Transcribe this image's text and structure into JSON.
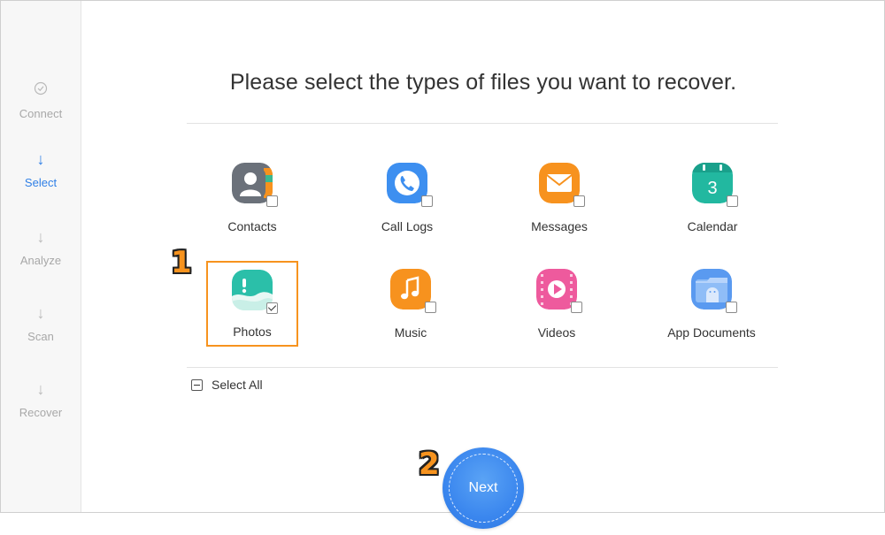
{
  "sidebar": {
    "steps": [
      {
        "label": "Connect",
        "icon": "check-circle-icon",
        "glyph": "✓"
      },
      {
        "label": "Select",
        "icon": "arrow-down-icon",
        "glyph": "↓"
      },
      {
        "label": "Analyze",
        "icon": "arrow-down-icon",
        "glyph": "↓"
      },
      {
        "label": "Scan",
        "icon": "arrow-down-icon",
        "glyph": "↓"
      },
      {
        "label": "Recover",
        "icon": "arrow-down-icon",
        "glyph": "↓"
      }
    ],
    "active_step": "Select",
    "active_color": "#2f7fe6"
  },
  "main": {
    "title": "Please select the types of files you want to recover.",
    "file_types": [
      {
        "label": "Contacts",
        "icon": "contacts-icon",
        "checked": false,
        "color": "#6b717a"
      },
      {
        "label": "Call Logs",
        "icon": "phone-icon",
        "checked": false,
        "color": "#3d8ff0"
      },
      {
        "label": "Messages",
        "icon": "envelope-icon",
        "checked": false,
        "color": "#f7921e"
      },
      {
        "label": "Calendar",
        "icon": "calendar-icon",
        "checked": false,
        "color": "#22b8a0",
        "calendar_day": "3"
      },
      {
        "label": "Photos",
        "icon": "photos-icon",
        "checked": true,
        "color": "#2bbfa9"
      },
      {
        "label": "Music",
        "icon": "music-note-icon",
        "checked": false,
        "color": "#f7921e"
      },
      {
        "label": "Videos",
        "icon": "play-icon",
        "checked": false,
        "color": "#ee5a9d"
      },
      {
        "label": "App Documents",
        "icon": "android-folder-icon",
        "checked": false,
        "color": "#5a9af0"
      }
    ],
    "select_all_label": "Select All",
    "next_label": "Next"
  },
  "annotations": {
    "step1": "1",
    "step2": "2",
    "highlight_color": "#f7931e"
  }
}
